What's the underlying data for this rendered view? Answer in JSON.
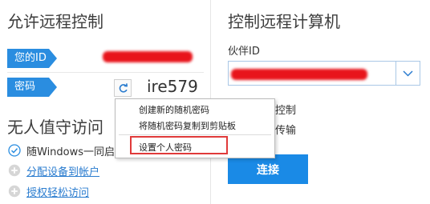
{
  "left": {
    "title": "允许远程控制",
    "id_label": "您的ID",
    "password_label": "密码",
    "password_value": "ire579",
    "unattended_title": "无人值守访问",
    "items": [
      {
        "icon": "check-circle-icon",
        "text": "随Windows一同启"
      },
      {
        "icon": "plus-circle-icon",
        "text": "分配设备到帐户"
      },
      {
        "icon": "plus-circle-icon",
        "text": "授权轻松访问"
      }
    ]
  },
  "context_menu": {
    "items": [
      "创建新的随机密码",
      "将随机密码复制到剪贴板",
      "设置个人密码"
    ]
  },
  "right": {
    "title": "控制远程计算机",
    "partner_id_label": "伙伴ID",
    "partner_id_value": "",
    "options": [
      "控制",
      "传输"
    ],
    "connect_label": "连接"
  },
  "colors": {
    "accent": "#2a8de0",
    "button": "#1a8ae6",
    "redaction": "#e8141b",
    "highlight": "#e03a3a",
    "link": "#2a7ccf"
  }
}
